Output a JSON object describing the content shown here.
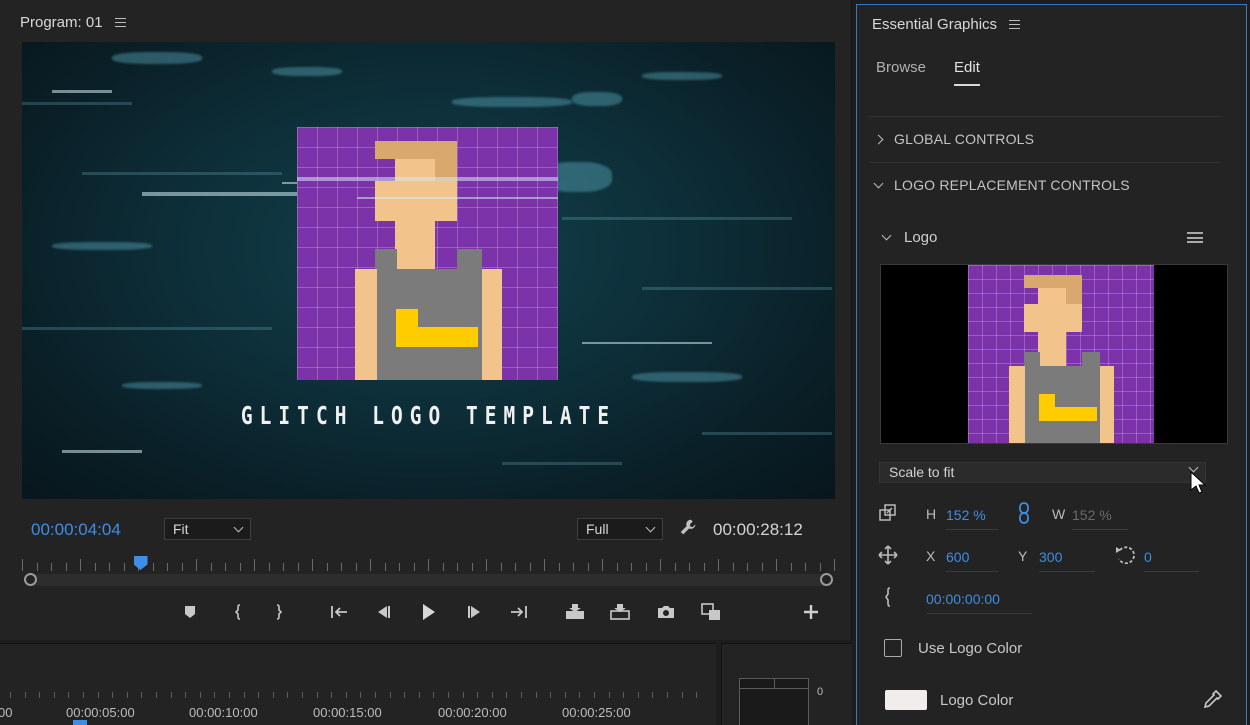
{
  "program": {
    "title": "Program: 01",
    "overlay_text": "GLITCH LOGO TEMPLATE",
    "current_time": "00:00:04:04",
    "zoom": "Fit",
    "resolution": "Full",
    "duration": "00:00:28:12",
    "playhead_fraction": 0.146
  },
  "timeline": {
    "labels": [
      "00",
      "00:00:05:00",
      "00:00:10:00",
      "00:00:15:00",
      "00:00:20:00",
      "00:00:25:00"
    ],
    "meter_zero": "0"
  },
  "eg": {
    "title": "Essential Graphics",
    "tabs": [
      {
        "label": "Browse",
        "active": false
      },
      {
        "label": "Edit",
        "active": true
      }
    ],
    "sections": {
      "global": "GLOBAL CONTROLS",
      "logo_replacement": "LOGO REPLACEMENT CONTROLS"
    },
    "logo": {
      "label": "Logo",
      "scale_mode": "Scale to fit",
      "h_label": "H",
      "h_value": "152 %",
      "w_label": "W",
      "w_value": "152 %",
      "x_label": "X",
      "x_value": "600",
      "y_label": "Y",
      "y_value": "300",
      "rotation_value": "0",
      "time_value": "00:00:00:00"
    },
    "use_logo_color": "Use Logo Color",
    "use_logo_color_checked": false,
    "logo_color_label": "Logo Color",
    "logo_color": "#f2eded"
  },
  "colors": {
    "accent": "#3d8ee6",
    "purple": "#7c32a8",
    "skin": "#f3c38c",
    "hair": "#d9a86e",
    "shirt": "#7b7b7b",
    "yellow": "#ffcc00"
  },
  "icons": {
    "menu": "hamburger-icon",
    "wrench": "wrench-icon",
    "link": "link-icon",
    "scale": "scale-icon",
    "position": "move-icon",
    "rotation": "rotate-icon",
    "anchor": "bracket-icon",
    "eyedropper": "eyedropper-icon"
  }
}
